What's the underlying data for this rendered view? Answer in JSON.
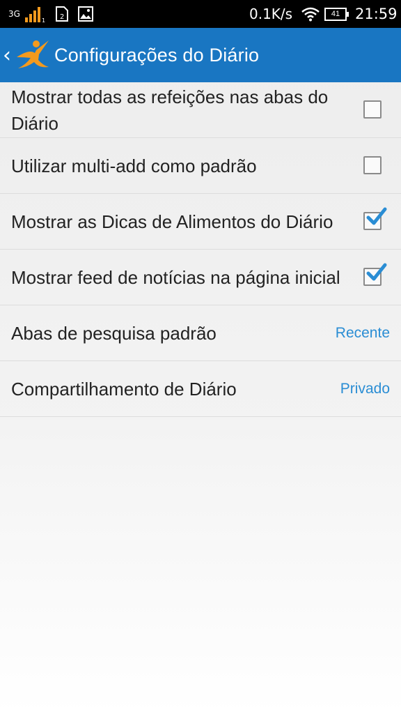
{
  "status_bar": {
    "network_type": "3G",
    "speed": "0.1K/s",
    "battery_level": "41",
    "time": "21:59",
    "icons": [
      "signal-icon",
      "sim-icon",
      "gallery-icon",
      "wifi-icon",
      "battery-icon"
    ]
  },
  "header": {
    "title": "Configurações do Diário",
    "back_icon": "chevron-left-icon",
    "logo_icon": "myfitnesspal-logo-icon",
    "color": "#1976c2",
    "logo_color": "#f39a1e"
  },
  "settings": {
    "items": [
      {
        "label": "Mostrar todas as refeições nas abas do Diário",
        "checked": false
      },
      {
        "label": "Utilizar multi-add como padrão",
        "checked": false
      },
      {
        "label": "Mostrar as Dicas de Alimentos do Diário",
        "checked": true
      },
      {
        "label": "Mostrar feed de notícias na página inicial",
        "checked": true
      }
    ],
    "value_items": [
      {
        "label": "Abas de pesquisa padrão",
        "value": "Recente"
      },
      {
        "label": "Compartilhamento de Diário",
        "value": "Privado"
      }
    ],
    "value_color": "#2a8dd4",
    "check_color": "#2a8dd4"
  }
}
